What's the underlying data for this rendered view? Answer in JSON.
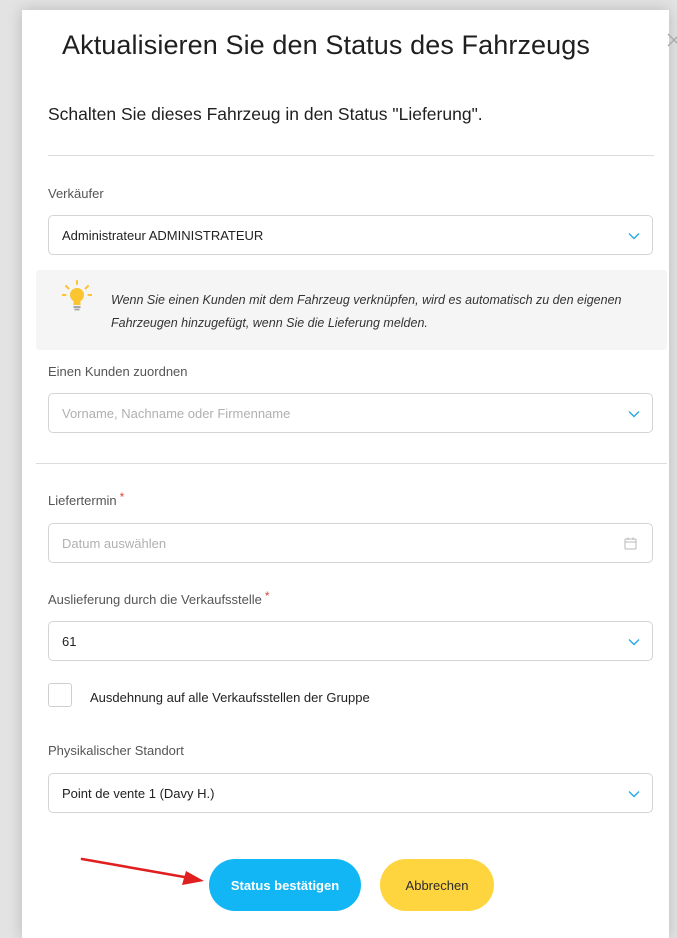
{
  "dialog": {
    "title": "Aktualisieren Sie den Status des Fahrzeugs",
    "subtitle": "Schalten Sie dieses Fahrzeug in den Status \"Lieferung\"."
  },
  "seller": {
    "label": "Verkäufer",
    "value": "Administrateur ADMINISTRATEUR"
  },
  "info": {
    "icon": "lightbulb-icon",
    "text": "Wenn Sie einen Kunden mit dem Fahrzeug verknüpfen, wird es automatisch zu den eigenen Fahrzeugen hinzugefügt, wenn Sie die Lieferung melden."
  },
  "customer": {
    "label": "Einen Kunden zuordnen",
    "placeholder": "Vorname, Nachname oder Firmenname"
  },
  "delivery_date": {
    "label": "Liefertermin",
    "required_mark": "*",
    "placeholder": "Datum auswählen"
  },
  "outlet": {
    "label": "Auslieferung durch die Verkaufsstelle",
    "required_mark": "*",
    "value": "61"
  },
  "extend_group": {
    "label": "Ausdehnung auf alle Verkaufsstellen der Gruppe",
    "checked": false
  },
  "physical_location": {
    "label": "Physikalischer Standort",
    "value": "Point de vente 1 (Davy H.)"
  },
  "buttons": {
    "confirm_label": "Status bestätigen",
    "cancel_label": "Abbrechen"
  },
  "colors": {
    "confirm": "#12b6f5",
    "cancel": "#ffd53f",
    "chevron": "#2aa8e0",
    "required": "#e0493d",
    "arrow": "#e02020",
    "bulb": "#fbc531"
  }
}
